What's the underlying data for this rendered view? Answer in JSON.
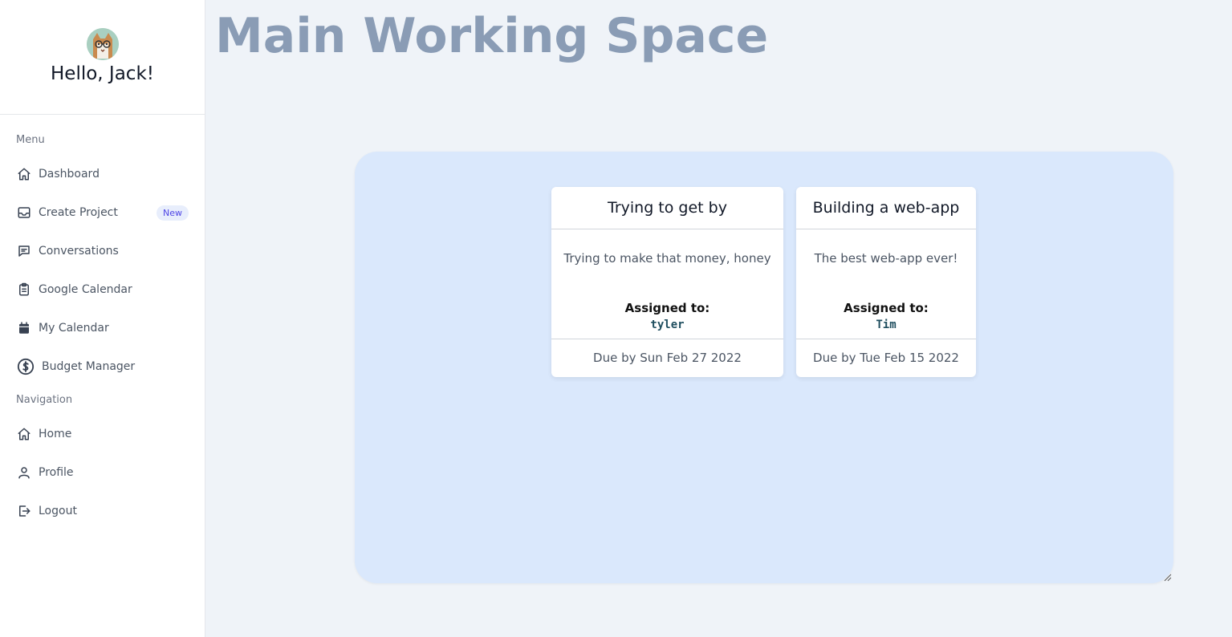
{
  "sidebar": {
    "greeting": "Hello, Jack!",
    "menu_label": "Menu",
    "menu_items": [
      {
        "label": "Dashboard",
        "icon": "home-icon"
      },
      {
        "label": "Create Project",
        "icon": "inbox-icon",
        "badge": "New"
      },
      {
        "label": "Conversations",
        "icon": "chat-icon"
      },
      {
        "label": "Google Calendar",
        "icon": "clipboard-icon"
      },
      {
        "label": "My Calendar",
        "icon": "calendar-icon"
      },
      {
        "label": "Budget Manager",
        "icon": "dollar-icon"
      }
    ],
    "navigation_label": "Navigation",
    "nav_items": [
      {
        "label": "Home",
        "icon": "home-icon"
      },
      {
        "label": "Profile",
        "icon": "user-icon"
      },
      {
        "label": "Logout",
        "icon": "logout-icon"
      }
    ]
  },
  "main": {
    "title": "Main Working Space",
    "cards": [
      {
        "title": "Trying to get by",
        "description": "Trying to make that money, honey",
        "assigned_label": "Assigned to:",
        "assignee": "tyler",
        "due": "Due by Sun Feb 27 2022"
      },
      {
        "title": "Building a web-app",
        "description": "The best web-app ever!",
        "assigned_label": "Assigned to:",
        "assignee": "Tim",
        "due": "Due by Tue Feb 15 2022"
      }
    ]
  },
  "colors": {
    "background": "#eff3f8",
    "board": "#dae8fc",
    "title": "#8a9cb5",
    "badge_text": "#4f46e5"
  }
}
